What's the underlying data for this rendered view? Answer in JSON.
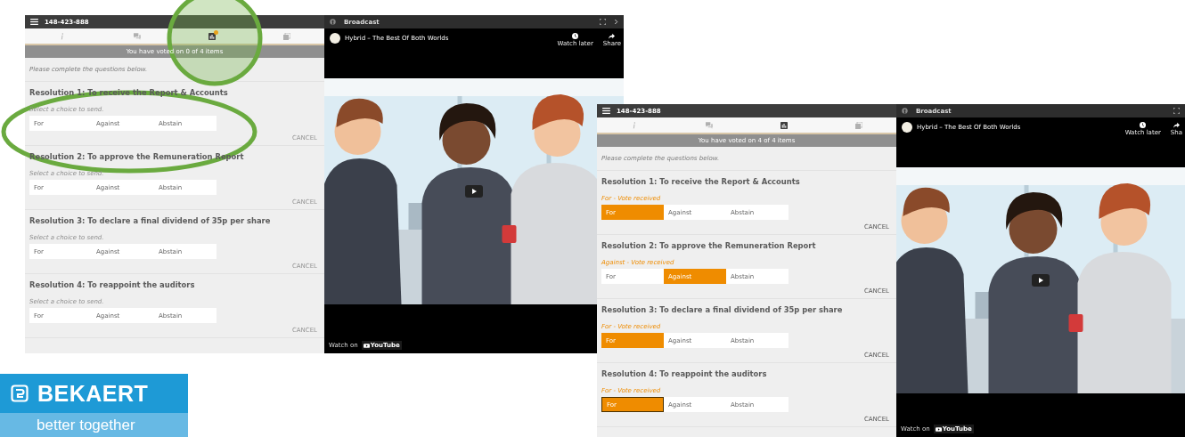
{
  "screenshots": [
    {
      "meeting_id": "148-423-888",
      "tabs": [
        {
          "kind": "info",
          "selected": false,
          "badge": false
        },
        {
          "kind": "chat",
          "selected": false,
          "badge": false
        },
        {
          "kind": "vote",
          "selected": true,
          "badge": true
        },
        {
          "kind": "documents",
          "selected": false,
          "badge": false
        }
      ],
      "status": "You have voted on 0 of 4 items",
      "intro": "Please complete the questions below.",
      "resolutions": [
        {
          "title": "Resolution 1: To receive the Report & Accounts",
          "hint": "Select a choice to send.",
          "vote_received": false,
          "options": [
            {
              "label": "For",
              "selected": false,
              "focused": false
            },
            {
              "label": "Against",
              "selected": false,
              "focused": false
            },
            {
              "label": "Abstain",
              "selected": false,
              "focused": false
            }
          ],
          "cancel": "CANCEL",
          "cancel_disabled": true
        },
        {
          "title": "Resolution 2: To approve the Remuneration Report",
          "hint": "Select a choice to send.",
          "vote_received": false,
          "options": [
            {
              "label": "For",
              "selected": false,
              "focused": false
            },
            {
              "label": "Against",
              "selected": false,
              "focused": false
            },
            {
              "label": "Abstain",
              "selected": false,
              "focused": false
            }
          ],
          "cancel": "CANCEL",
          "cancel_disabled": true
        },
        {
          "title": "Resolution 3: To declare a final dividend of 35p per share",
          "hint": "Select a choice to send.",
          "vote_received": false,
          "options": [
            {
              "label": "For",
              "selected": false,
              "focused": false
            },
            {
              "label": "Against",
              "selected": false,
              "focused": false
            },
            {
              "label": "Abstain",
              "selected": false,
              "focused": false
            }
          ],
          "cancel": "CANCEL",
          "cancel_disabled": true
        },
        {
          "title": "Resolution 4: To reappoint the auditors",
          "hint": "Select a choice to send.",
          "vote_received": false,
          "options": [
            {
              "label": "For",
              "selected": false,
              "focused": false
            },
            {
              "label": "Against",
              "selected": false,
              "focused": false
            },
            {
              "label": "Abstain",
              "selected": false,
              "focused": false
            }
          ],
          "cancel": "CANCEL",
          "cancel_disabled": true
        }
      ],
      "broadcast": {
        "title": "Broadcast",
        "next_arrow": true,
        "video_title": "Hybrid – The Best Of Both Worlds",
        "actions": [
          {
            "kind": "clock",
            "label": "Watch later"
          },
          {
            "kind": "share",
            "label": "Share"
          }
        ],
        "watch_on": "Watch on",
        "brand": "YouTube"
      }
    },
    {
      "meeting_id": "148-423-888",
      "tabs": [
        {
          "kind": "info",
          "selected": false,
          "badge": false
        },
        {
          "kind": "chat",
          "selected": false,
          "badge": false
        },
        {
          "kind": "vote",
          "selected": true,
          "badge": false
        },
        {
          "kind": "documents",
          "selected": false,
          "badge": false
        }
      ],
      "status": "You have voted on 4 of 4 items",
      "intro": "Please complete the questions below.",
      "resolutions": [
        {
          "title": "Resolution 1: To receive the Report & Accounts",
          "hint": "For - Vote received",
          "vote_received": true,
          "options": [
            {
              "label": "For",
              "selected": true,
              "focused": false
            },
            {
              "label": "Against",
              "selected": false,
              "focused": false
            },
            {
              "label": "Abstain",
              "selected": false,
              "focused": false
            }
          ],
          "cancel": "CANCEL",
          "cancel_disabled": false
        },
        {
          "title": "Resolution 2: To approve the Remuneration Report",
          "hint": "Against - Vote received",
          "vote_received": true,
          "options": [
            {
              "label": "For",
              "selected": false,
              "focused": false
            },
            {
              "label": "Against",
              "selected": true,
              "focused": false
            },
            {
              "label": "Abstain",
              "selected": false,
              "focused": false
            }
          ],
          "cancel": "CANCEL",
          "cancel_disabled": false
        },
        {
          "title": "Resolution 3: To declare a final dividend of 35p per share",
          "hint": "For - Vote received",
          "vote_received": true,
          "options": [
            {
              "label": "For",
              "selected": true,
              "focused": false
            },
            {
              "label": "Against",
              "selected": false,
              "focused": false
            },
            {
              "label": "Abstain",
              "selected": false,
              "focused": false
            }
          ],
          "cancel": "CANCEL",
          "cancel_disabled": false
        },
        {
          "title": "Resolution 4: To reappoint the auditors",
          "hint": "For - Vote received",
          "vote_received": true,
          "options": [
            {
              "label": "For",
              "selected": true,
              "focused": true
            },
            {
              "label": "Against",
              "selected": false,
              "focused": false
            },
            {
              "label": "Abstain",
              "selected": false,
              "focused": false
            }
          ],
          "cancel": "CANCEL",
          "cancel_disabled": false
        }
      ],
      "broadcast": {
        "title": "Broadcast",
        "next_arrow": false,
        "video_title": "Hybrid – The Best Of Both Worlds",
        "actions": [
          {
            "kind": "clock",
            "label": "Watch later"
          },
          {
            "kind": "share",
            "label": "Sha"
          }
        ],
        "watch_on": "Watch on",
        "brand": "YouTube"
      }
    }
  ],
  "logo": {
    "name": "BEKAERT",
    "tagline": "better together"
  }
}
